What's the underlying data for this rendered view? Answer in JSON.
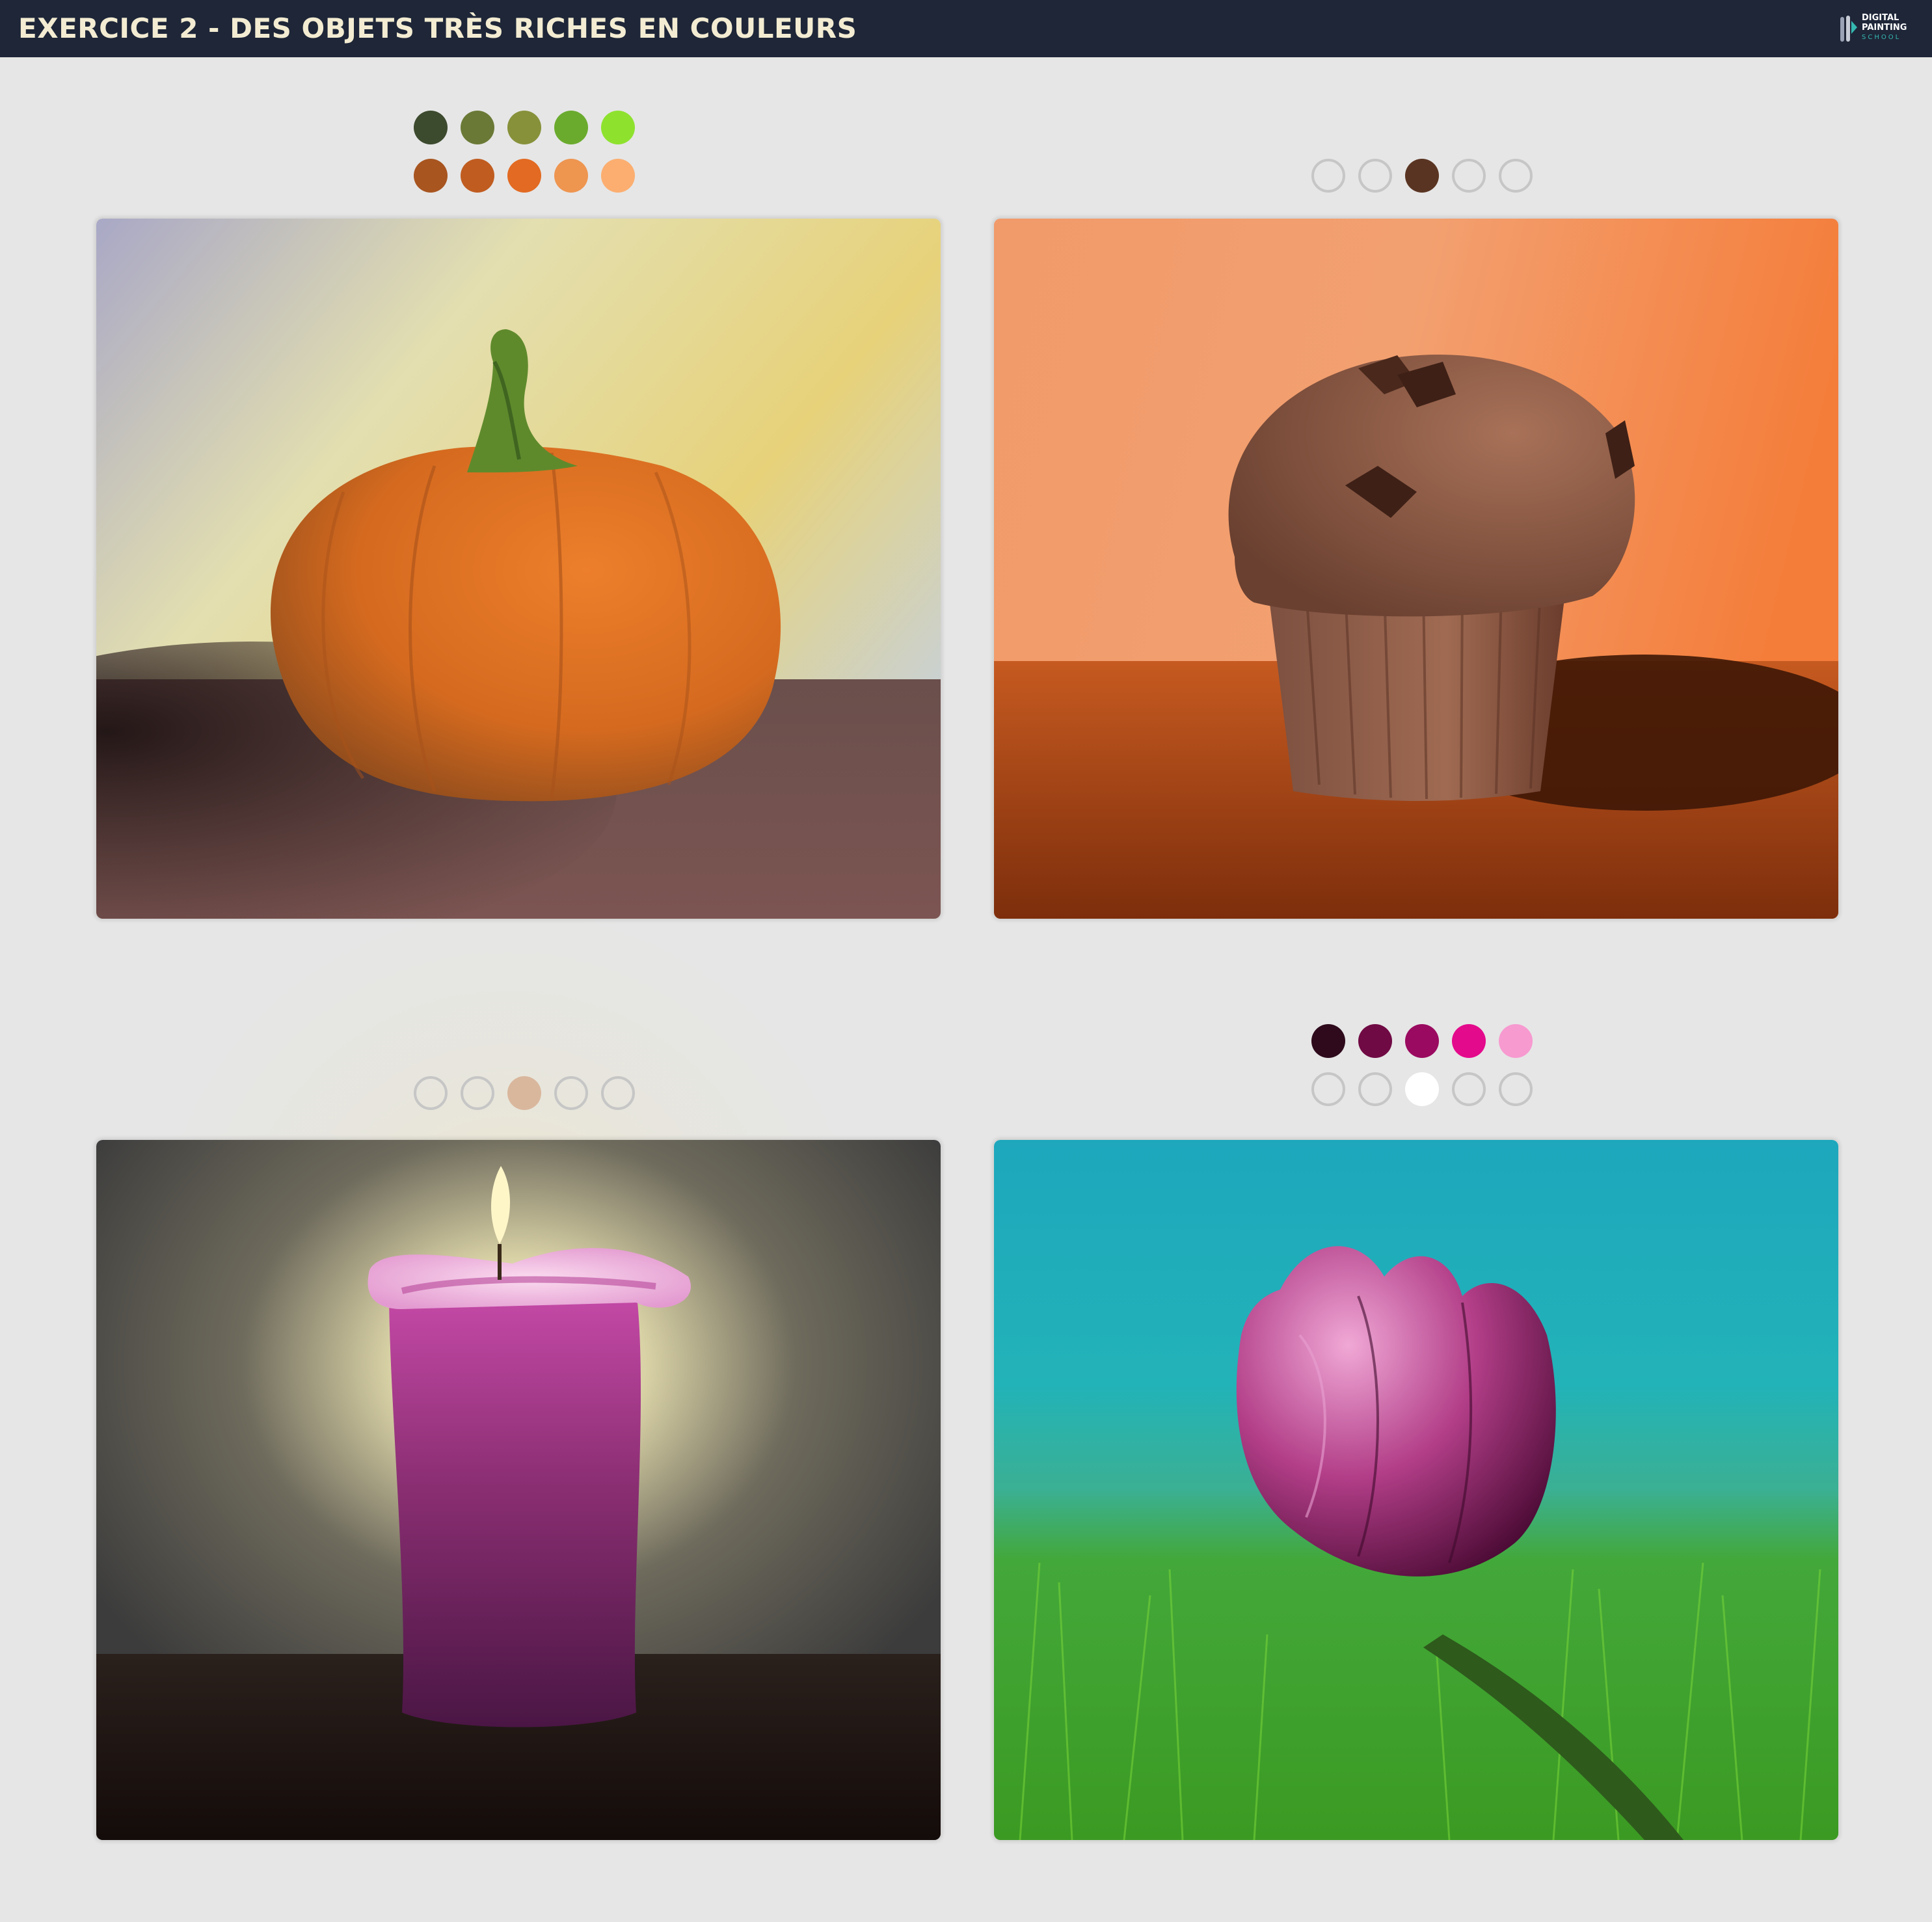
{
  "header": {
    "title": "EXERCICE 2 - DES OBJETS TRÈS RICHES EN COULEURS",
    "logo": {
      "line1": "DIGITAL",
      "line2": "PAINTING",
      "line3": "SCHOOL",
      "icon": "brush-logo-icon"
    }
  },
  "panels": [
    {
      "subject": "pumpkin",
      "palette": [
        [
          "#3c4a2e",
          "#6a7a36",
          "#87913a",
          "#6aab2e",
          "#8ee22e"
        ],
        [
          "#a85520",
          "#c05c20",
          "#e26a22",
          "#ee9550",
          "#fbae70"
        ]
      ]
    },
    {
      "subject": "muffin",
      "palette": [
        [
          null,
          null,
          "#5a3422",
          null,
          null
        ]
      ]
    },
    {
      "subject": "candle",
      "palette": [
        [
          null,
          null,
          "#d9b79d",
          null,
          null
        ]
      ]
    },
    {
      "subject": "tulip",
      "palette": [
        [
          "#2e0a1c",
          "#700a44",
          "#9a0a60",
          "#e40a8c",
          "#f79ad0"
        ],
        [
          null,
          null,
          "#ffffff",
          null,
          null
        ]
      ]
    }
  ],
  "colors": {
    "topbar": "#1e2638",
    "title": "#f3ecd2",
    "background": "#e6e6e6",
    "empty_swatch_border": "#c6c6c6",
    "logo_accent": "#35b8b0"
  }
}
